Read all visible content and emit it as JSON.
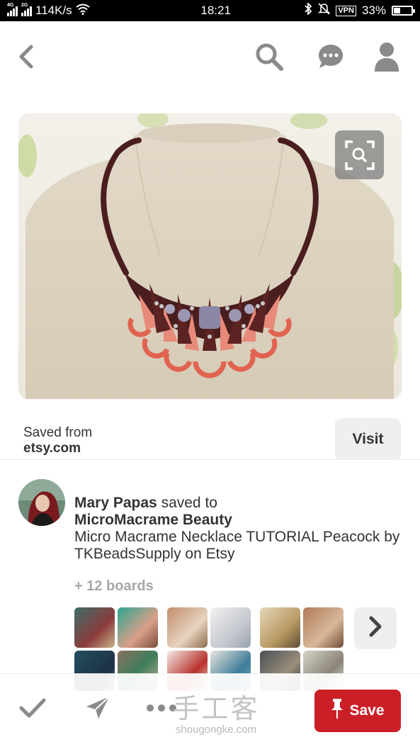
{
  "status_bar": {
    "network_a": "4G",
    "network_b": "2G",
    "speed": "114K/s",
    "time": "18:21",
    "vpn": "VPN",
    "battery": "33%"
  },
  "nav": {
    "icons": [
      "back-arrow-icon",
      "search-icon",
      "chat-icon",
      "profile-icon"
    ]
  },
  "pin": {
    "saved_from_label": "Saved from",
    "source_domain": "etsy.com",
    "visit_label": "Visit"
  },
  "saver": {
    "name": "Mary Papas",
    "saved_to": " saved to",
    "board": "MicroMacrame Beauty",
    "description": "Micro Macrame Necklace TUTORIAL Peacock by TKBeadsSupply on Etsy",
    "more_boards": "+ 12 boards"
  },
  "bottom_bar": {
    "watermark_cn": "手工客",
    "watermark_url": "shougongke.com",
    "save_label": "Save"
  },
  "colors": {
    "save_red": "#cb1f27",
    "cord_brown": "#4a1e1e",
    "coral": "#e1634f"
  }
}
